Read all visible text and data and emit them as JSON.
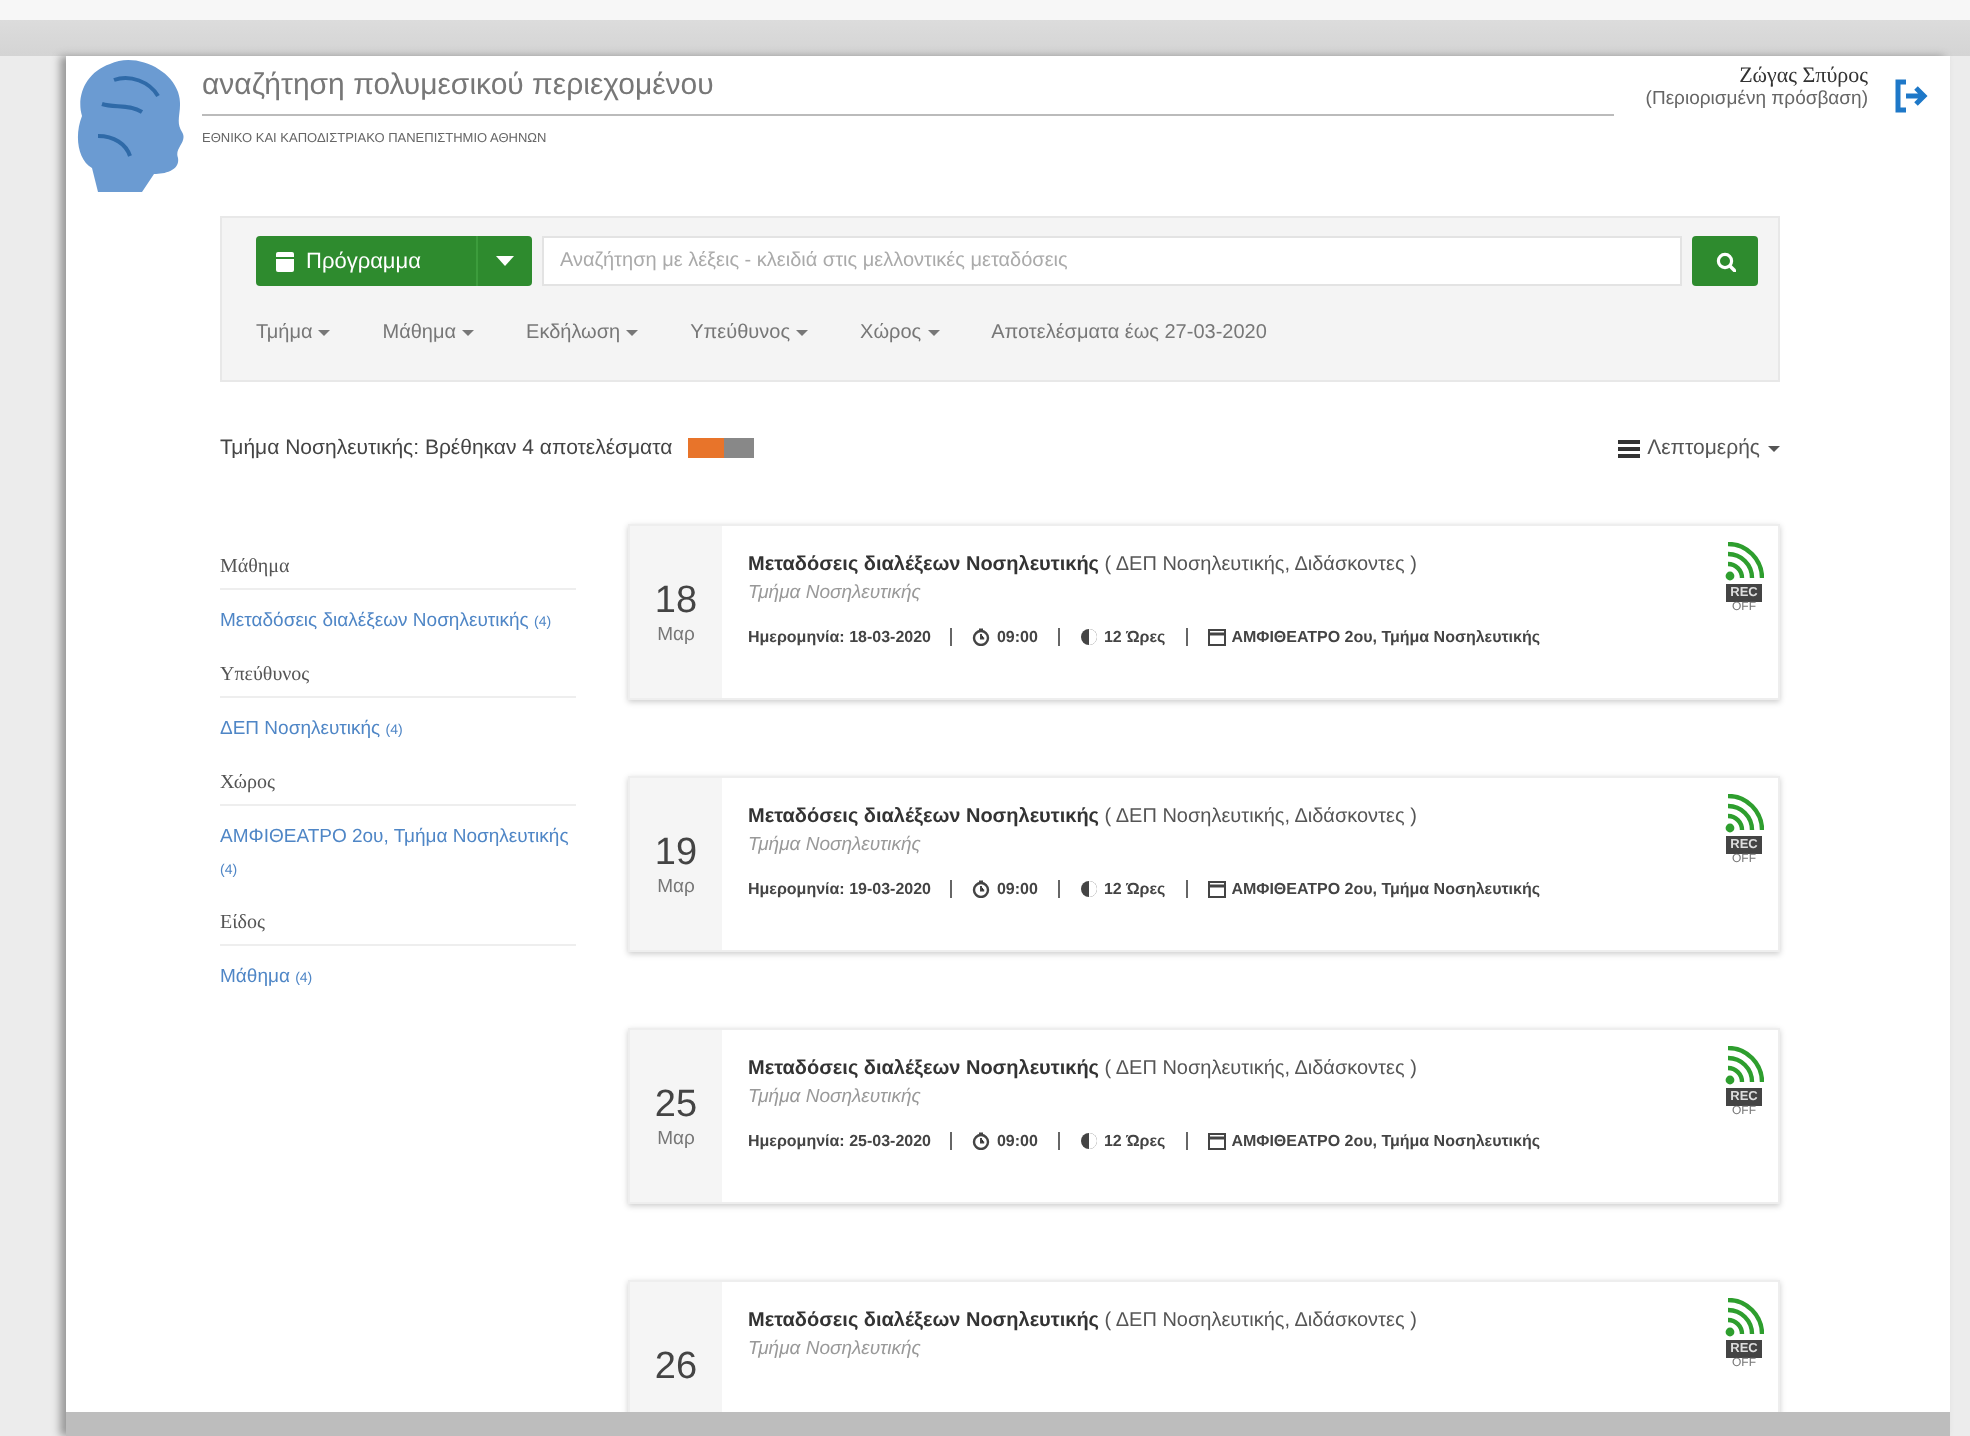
{
  "header": {
    "title": "αναζήτηση πολυμεσικού περιεχομένου",
    "institution": "ΕΘΝΙΚΟ ΚΑΙ ΚΑΠΟΔΙΣΤΡΙΑΚΟ ΠΑΝΕΠΙΣΤΗΜΙΟ ΑΘΗΝΩΝ",
    "user": {
      "name": "Ζώγας Σπύρος",
      "access": "(Περιορισμένη πρόσβαση)"
    }
  },
  "search": {
    "scope_button": "Πρόγραμμα",
    "placeholder": "Αναζήτηση με λέξεις - κλειδιά στις μελλοντικές μεταδόσεις"
  },
  "filters": [
    {
      "kind": "dropdown",
      "label": "Τμήμα"
    },
    {
      "kind": "dropdown",
      "label": "Μάθημα"
    },
    {
      "kind": "dropdown",
      "label": "Εκδήλωση"
    },
    {
      "kind": "dropdown",
      "label": "Υπεύθυνος"
    },
    {
      "kind": "dropdown",
      "label": "Χώρος"
    },
    {
      "kind": "text",
      "label": "Αποτελέσματα έως 27-03-2020"
    }
  ],
  "results": {
    "summary": "Τμήμα Νοσηλευτικής: Βρέθηκαν 4 αποτελέσματα",
    "view_menu": "Λεπτομερής"
  },
  "facets": [
    {
      "heading": "Μάθημα",
      "items": [
        {
          "label": "Μεταδόσεις διαλέξεων Νοσηλευτικής",
          "count": "(4)"
        }
      ]
    },
    {
      "heading": "Υπεύθυνος",
      "items": [
        {
          "label": "ΔΕΠ Νοσηλευτικής",
          "count": "(4)"
        }
      ]
    },
    {
      "heading": "Χώρος",
      "items": [
        {
          "label": "ΑΜΦΙΘΕΑΤΡΟ 2ου, Τμήμα Νοσηλευτικής",
          "count": "(4)"
        }
      ]
    },
    {
      "heading": "Είδος",
      "items": [
        {
          "label": "Μάθημα",
          "count": "(4)"
        }
      ]
    }
  ],
  "events": [
    {
      "day": "18",
      "month": "Μαρ",
      "title": "**Μεταδόσεις διαλέξεων Νοσηλευτικής** ( ΔΕΠ Νοσηλευτικής, Διδάσκοντες )",
      "department": "Τμήμα Νοσηλευτικής",
      "date": "Ημερομηνία: 18-03-2020",
      "time": "09:00",
      "duration": "12 Ώρες",
      "location": "ΑΜΦΙΘΕΑΤΡΟ 2ου, Τμήμα Νοσηλευτικής",
      "rec": "REC",
      "rec_status": "OFF"
    },
    {
      "day": "19",
      "month": "Μαρ",
      "title": "**Μεταδόσεις διαλέξεων Νοσηλευτικής** ( ΔΕΠ Νοσηλευτικής, Διδάσκοντες )",
      "department": "Τμήμα Νοσηλευτικής",
      "date": "Ημερομηνία: 19-03-2020",
      "time": "09:00",
      "duration": "12 Ώρες",
      "location": "ΑΜΦΙΘΕΑΤΡΟ 2ου, Τμήμα Νοσηλευτικής",
      "rec": "REC",
      "rec_status": "OFF"
    },
    {
      "day": "25",
      "month": "Μαρ",
      "title": "**Μεταδόσεις διαλέξεων Νοσηλευτικής** ( ΔΕΠ Νοσηλευτικής, Διδάσκοντες )",
      "department": "Τμήμα Νοσηλευτικής",
      "date": "Ημερομηνία: 25-03-2020",
      "time": "09:00",
      "duration": "12 Ώρες",
      "location": "ΑΜΦΙΘΕΑΤΡΟ 2ου, Τμήμα Νοσηλευτικής",
      "rec": "REC",
      "rec_status": "OFF"
    },
    {
      "day": "26",
      "title": "**Μεταδόσεις διαλέξεων Νοσηλευτικής** ( ΔΕΠ Νοσηλευτικής, Διδάσκοντες )",
      "department": "Τμήμα Νοσηλευτικής",
      "rec": "REC",
      "rec_status": "OFF"
    }
  ]
}
